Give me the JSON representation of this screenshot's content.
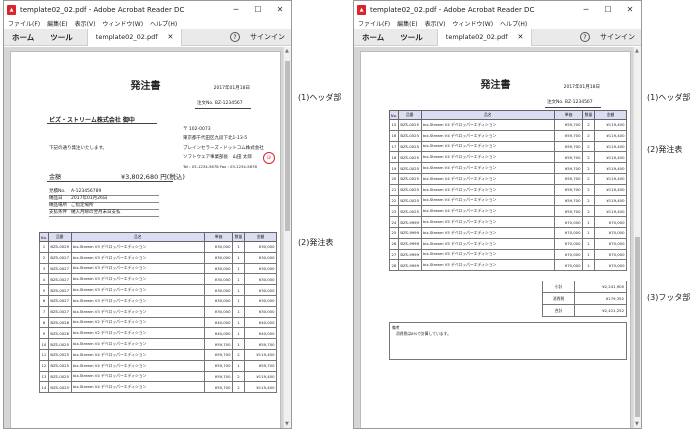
{
  "window": {
    "title": "template02_02.pdf - Adobe Acrobat Reader DC",
    "menu": [
      "ファイル(F)",
      "編集(E)",
      "表示(V)",
      "ウィンドウ(W)",
      "ヘルプ(H)"
    ],
    "tabs": {
      "home": "ホーム",
      "tools": "ツール",
      "doc": "template02_02.pdf",
      "signin": "サインイン"
    }
  },
  "doc": {
    "title": "発注書",
    "date": "2017年01月18日",
    "order_no": "注文No.  BZ-1234567",
    "customer": "ビズ・ストリーム株式会社 御中",
    "postal": "〒 102-0073",
    "address": "東京都千代田区九段下北1-13-5",
    "company": "ブレインセラーズ・ドットコム株式会社",
    "dept": "ソフトウェア事業部長　山田 太郎",
    "tel": "Tel : 03-1234-5678  Fax : 03-1234-5678",
    "intro": "下記の通り発注いたします。",
    "amount_label": "金額",
    "amount_value": "¥3,802,680 円(税込)",
    "info": [
      {
        "label": "見積No.",
        "value": "A-123456789"
      },
      {
        "label": "納品日",
        "value": "2017年01月26日"
      },
      {
        "label": "納品場所",
        "value": "ご指定場所"
      },
      {
        "label": "支払条件",
        "value": "納入月締の翌月末日支払"
      }
    ],
    "stamp": "印"
  },
  "table": {
    "headers": [
      "No.",
      "品番",
      "品名",
      "単価",
      "数量",
      "金額"
    ],
    "page1_rows": [
      [
        "1",
        "BZS-0029",
        "biz-Stream V3 デベロッパーエディション",
        "¥30,000",
        "1",
        "¥30,000"
      ],
      [
        "2",
        "BZS-0027",
        "biz-Stream V3 デベロッパーエディション",
        "¥30,000",
        "1",
        "¥30,000"
      ],
      [
        "3",
        "BZS-0027",
        "biz-Stream V3 デベロッパーエディション",
        "¥30,000",
        "1",
        "¥30,000"
      ],
      [
        "4",
        "BZS-0027",
        "biz-Stream V3 デベロッパーエディション",
        "¥30,000",
        "1",
        "¥30,000"
      ],
      [
        "5",
        "BZS-0027",
        "biz-Stream V3 デベロッパーエディション",
        "¥30,000",
        "1",
        "¥30,000"
      ],
      [
        "6",
        "BZS-0027",
        "biz-Stream V3 デベロッパーエディション",
        "¥30,000",
        "1",
        "¥30,000"
      ],
      [
        "7",
        "BZS-0027",
        "biz-Stream V3 デベロッパーエディション",
        "¥30,000",
        "1",
        "¥30,000"
      ],
      [
        "8",
        "BZS-0026",
        "biz-Stream V2 デベロッパーエディション",
        "¥40,000",
        "1",
        "¥40,000"
      ],
      [
        "9",
        "BZS-0026",
        "biz-Stream V2 デベロッパーエディション",
        "¥40,000",
        "1",
        "¥40,000"
      ],
      [
        "10",
        "BZS-0025",
        "biz-Stream V4 デベロッパーエディション",
        "¥59,700",
        "1",
        "¥59,700"
      ],
      [
        "11",
        "BZS-0025",
        "biz-Stream V4 デベロッパーエディション",
        "¥59,700",
        "2",
        "¥119,400"
      ],
      [
        "12",
        "BZS-0025",
        "biz-Stream V4 デベロッパーエディション",
        "¥59,700",
        "1",
        "¥59,700"
      ],
      [
        "13",
        "BZS-0025",
        "biz-Stream V4 デベロッパーエディション",
        "¥59,700",
        "2",
        "¥119,400"
      ],
      [
        "14",
        "BZS-0025",
        "biz-Stream V4 デベロッパーエディション",
        "¥59,700",
        "2",
        "¥119,400"
      ]
    ],
    "page2_rows": [
      [
        "15",
        "BZS-0025",
        "biz-Stream V4 デベロッパーエディション",
        "¥59,700",
        "2",
        "¥119,400"
      ],
      [
        "16",
        "BZS-0025",
        "biz-Stream V4 デベロッパーエディション",
        "¥59,700",
        "2",
        "¥119,400"
      ],
      [
        "17",
        "BZS-0025",
        "biz-Stream V4 デベロッパーエディション",
        "¥59,700",
        "2",
        "¥119,400"
      ],
      [
        "18",
        "BZS-0025",
        "biz-Stream V4 デベロッパーエディション",
        "¥59,700",
        "2",
        "¥119,400"
      ],
      [
        "19",
        "BZS-0025",
        "biz-Stream V4 デベロッパーエディション",
        "¥59,700",
        "2",
        "¥119,400"
      ],
      [
        "20",
        "BZS-0025",
        "biz-Stream V4 デベロッパーエディション",
        "¥59,700",
        "2",
        "¥119,400"
      ],
      [
        "21",
        "BZS-0025",
        "biz-Stream V4 デベロッパーエディション",
        "¥59,700",
        "2",
        "¥119,400"
      ],
      [
        "22",
        "BZS-0025",
        "biz-Stream V4 デベロッパーエディション",
        "¥59,700",
        "2",
        "¥119,400"
      ],
      [
        "23",
        "BZS-0025",
        "biz-Stream V4 デベロッパーエディション",
        "¥59,700",
        "2",
        "¥119,400"
      ],
      [
        "24",
        "BZS-9999",
        "biz-Stream V5 デベロッパーエディション",
        "¥70,000",
        "1",
        "¥70,000"
      ],
      [
        "25",
        "BZS-9999",
        "biz-Stream V5 デベロッパーエディション",
        "¥70,000",
        "1",
        "¥70,000"
      ],
      [
        "26",
        "BZS-9999",
        "biz-Stream V5 デベロッパーエディション",
        "¥70,000",
        "1",
        "¥70,000"
      ],
      [
        "27",
        "BZS-9999",
        "biz-Stream V5 デベロッパーエディション",
        "¥70,000",
        "1",
        "¥70,000"
      ],
      [
        "28",
        "BZS-9999",
        "biz-Stream V5 デベロッパーエディション",
        "¥70,000",
        "1",
        "¥70,000"
      ]
    ],
    "totals": [
      {
        "label": "小計",
        "value": "¥2,241,900"
      },
      {
        "label": "消費税",
        "value": "¥179,352"
      },
      {
        "label": "合計",
        "value": "¥2,421,252"
      }
    ],
    "notes_label": "備考",
    "notes": "消費税は8%で計算しています。"
  },
  "callouts": {
    "header1": "(1)ヘッダ部",
    "table1": "(2)発注表",
    "header2": "(1)ヘッダ部",
    "table2": "(2)発注表",
    "footer2": "(3)フッタ部"
  }
}
